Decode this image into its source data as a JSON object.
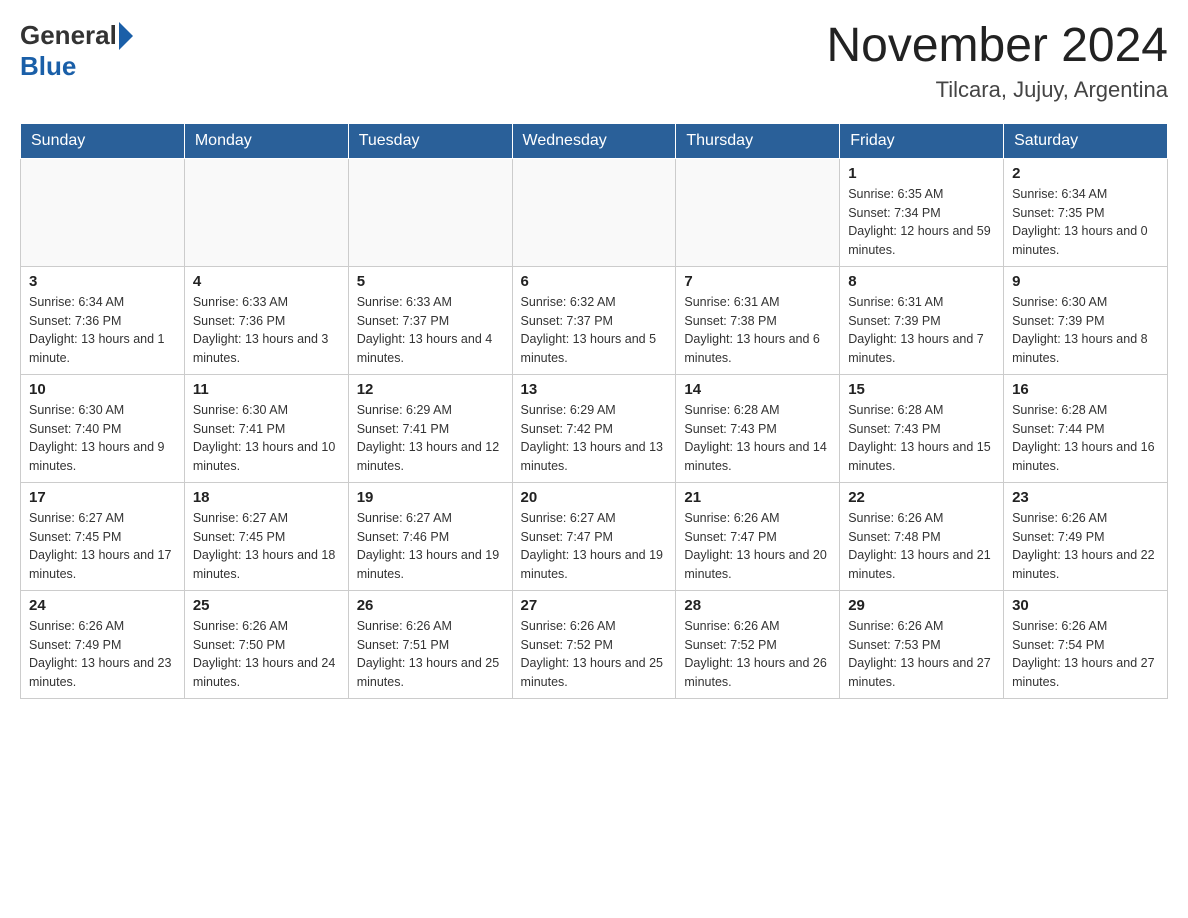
{
  "header": {
    "logo_general": "General",
    "logo_blue": "Blue",
    "month_year": "November 2024",
    "location": "Tilcara, Jujuy, Argentina"
  },
  "weekdays": [
    "Sunday",
    "Monday",
    "Tuesday",
    "Wednesday",
    "Thursday",
    "Friday",
    "Saturday"
  ],
  "weeks": [
    [
      {
        "day": "",
        "info": ""
      },
      {
        "day": "",
        "info": ""
      },
      {
        "day": "",
        "info": ""
      },
      {
        "day": "",
        "info": ""
      },
      {
        "day": "",
        "info": ""
      },
      {
        "day": "1",
        "info": "Sunrise: 6:35 AM\nSunset: 7:34 PM\nDaylight: 12 hours and 59 minutes."
      },
      {
        "day": "2",
        "info": "Sunrise: 6:34 AM\nSunset: 7:35 PM\nDaylight: 13 hours and 0 minutes."
      }
    ],
    [
      {
        "day": "3",
        "info": "Sunrise: 6:34 AM\nSunset: 7:36 PM\nDaylight: 13 hours and 1 minute."
      },
      {
        "day": "4",
        "info": "Sunrise: 6:33 AM\nSunset: 7:36 PM\nDaylight: 13 hours and 3 minutes."
      },
      {
        "day": "5",
        "info": "Sunrise: 6:33 AM\nSunset: 7:37 PM\nDaylight: 13 hours and 4 minutes."
      },
      {
        "day": "6",
        "info": "Sunrise: 6:32 AM\nSunset: 7:37 PM\nDaylight: 13 hours and 5 minutes."
      },
      {
        "day": "7",
        "info": "Sunrise: 6:31 AM\nSunset: 7:38 PM\nDaylight: 13 hours and 6 minutes."
      },
      {
        "day": "8",
        "info": "Sunrise: 6:31 AM\nSunset: 7:39 PM\nDaylight: 13 hours and 7 minutes."
      },
      {
        "day": "9",
        "info": "Sunrise: 6:30 AM\nSunset: 7:39 PM\nDaylight: 13 hours and 8 minutes."
      }
    ],
    [
      {
        "day": "10",
        "info": "Sunrise: 6:30 AM\nSunset: 7:40 PM\nDaylight: 13 hours and 9 minutes."
      },
      {
        "day": "11",
        "info": "Sunrise: 6:30 AM\nSunset: 7:41 PM\nDaylight: 13 hours and 10 minutes."
      },
      {
        "day": "12",
        "info": "Sunrise: 6:29 AM\nSunset: 7:41 PM\nDaylight: 13 hours and 12 minutes."
      },
      {
        "day": "13",
        "info": "Sunrise: 6:29 AM\nSunset: 7:42 PM\nDaylight: 13 hours and 13 minutes."
      },
      {
        "day": "14",
        "info": "Sunrise: 6:28 AM\nSunset: 7:43 PM\nDaylight: 13 hours and 14 minutes."
      },
      {
        "day": "15",
        "info": "Sunrise: 6:28 AM\nSunset: 7:43 PM\nDaylight: 13 hours and 15 minutes."
      },
      {
        "day": "16",
        "info": "Sunrise: 6:28 AM\nSunset: 7:44 PM\nDaylight: 13 hours and 16 minutes."
      }
    ],
    [
      {
        "day": "17",
        "info": "Sunrise: 6:27 AM\nSunset: 7:45 PM\nDaylight: 13 hours and 17 minutes."
      },
      {
        "day": "18",
        "info": "Sunrise: 6:27 AM\nSunset: 7:45 PM\nDaylight: 13 hours and 18 minutes."
      },
      {
        "day": "19",
        "info": "Sunrise: 6:27 AM\nSunset: 7:46 PM\nDaylight: 13 hours and 19 minutes."
      },
      {
        "day": "20",
        "info": "Sunrise: 6:27 AM\nSunset: 7:47 PM\nDaylight: 13 hours and 19 minutes."
      },
      {
        "day": "21",
        "info": "Sunrise: 6:26 AM\nSunset: 7:47 PM\nDaylight: 13 hours and 20 minutes."
      },
      {
        "day": "22",
        "info": "Sunrise: 6:26 AM\nSunset: 7:48 PM\nDaylight: 13 hours and 21 minutes."
      },
      {
        "day": "23",
        "info": "Sunrise: 6:26 AM\nSunset: 7:49 PM\nDaylight: 13 hours and 22 minutes."
      }
    ],
    [
      {
        "day": "24",
        "info": "Sunrise: 6:26 AM\nSunset: 7:49 PM\nDaylight: 13 hours and 23 minutes."
      },
      {
        "day": "25",
        "info": "Sunrise: 6:26 AM\nSunset: 7:50 PM\nDaylight: 13 hours and 24 minutes."
      },
      {
        "day": "26",
        "info": "Sunrise: 6:26 AM\nSunset: 7:51 PM\nDaylight: 13 hours and 25 minutes."
      },
      {
        "day": "27",
        "info": "Sunrise: 6:26 AM\nSunset: 7:52 PM\nDaylight: 13 hours and 25 minutes."
      },
      {
        "day": "28",
        "info": "Sunrise: 6:26 AM\nSunset: 7:52 PM\nDaylight: 13 hours and 26 minutes."
      },
      {
        "day": "29",
        "info": "Sunrise: 6:26 AM\nSunset: 7:53 PM\nDaylight: 13 hours and 27 minutes."
      },
      {
        "day": "30",
        "info": "Sunrise: 6:26 AM\nSunset: 7:54 PM\nDaylight: 13 hours and 27 minutes."
      }
    ]
  ]
}
